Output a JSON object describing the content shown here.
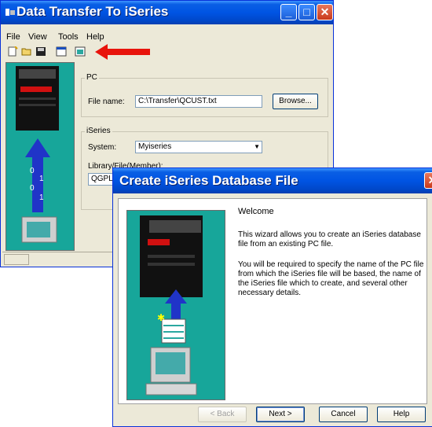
{
  "back_window": {
    "title": "Data Transfer To iSeries",
    "menu": [
      "File",
      "View",
      "Tools",
      "Help"
    ],
    "pc_group": {
      "title": "PC",
      "file_name_label": "File name:",
      "file_name_value": "C:\\Transfer\\QCUST.txt",
      "browse_label": "Browse..."
    },
    "iseries_group": {
      "title": "iSeries",
      "system_label": "System:",
      "system_value": "Myiseries",
      "library_label": "Library/File(Member):",
      "library_value": "QGPL/"
    }
  },
  "wizard": {
    "title": "Create iSeries Database File",
    "heading": "Welcome",
    "paragraph1": "This wizard allows you to create an iSeries database file from an existing PC file.",
    "paragraph2": "You will be required to specify the name of the PC file from which the iSeries file will be based, the name of the iSeries file which to create, and several other necessary details.",
    "buttons": {
      "back": "< Back",
      "next": "Next >",
      "cancel": "Cancel",
      "help": "Help"
    }
  },
  "colors": {
    "title_blue": "#0054e3",
    "illustration_teal": "#17a69a",
    "annotation_arrow": "#e8140c"
  },
  "icons": [
    "new-icon",
    "open-icon",
    "save-icon",
    "properties-icon",
    "create-database-file-icon",
    "close-icon",
    "minimize-icon",
    "maximize-icon"
  ]
}
